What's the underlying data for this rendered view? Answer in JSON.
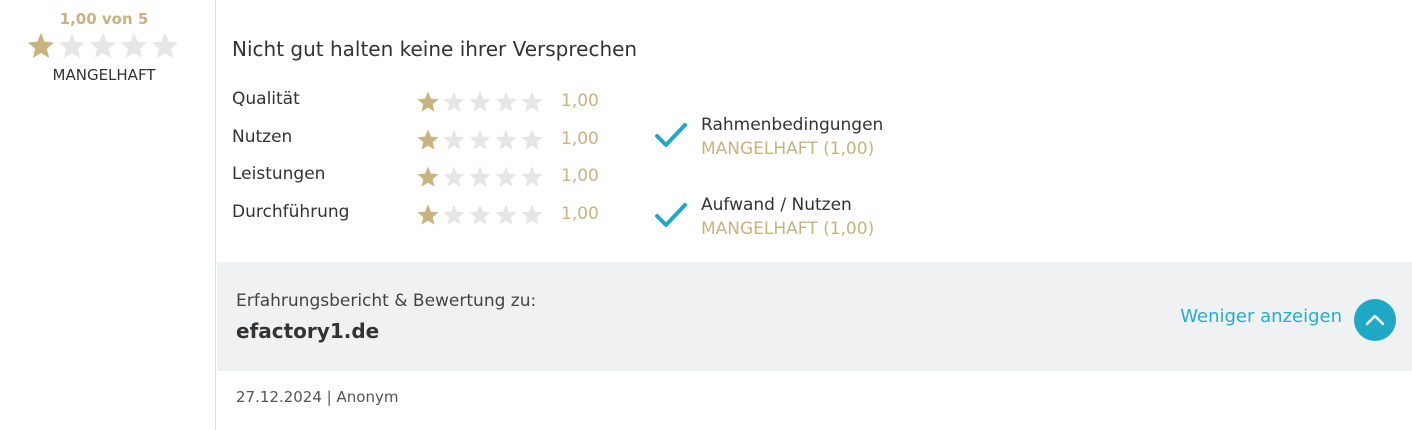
{
  "overall": {
    "score_label": "1,00 von 5",
    "rating": 1,
    "max_rating": 5,
    "verdict": "MANGELHAFT"
  },
  "review": {
    "title": "Nicht gut halten keine ihrer Versprechen"
  },
  "criteria": [
    {
      "label": "Qualität",
      "rating": 1,
      "value": "1,00"
    },
    {
      "label": "Nutzen",
      "rating": 1,
      "value": "1,00"
    },
    {
      "label": "Leistungen",
      "rating": 1,
      "value": "1,00"
    },
    {
      "label": "Durchführung",
      "rating": 1,
      "value": "1,00"
    }
  ],
  "recommendations": [
    {
      "title": "Rahmenbedingungen",
      "value": "MANGELHAFT (1,00)",
      "icon": "checkmark-icon"
    },
    {
      "title": "Aufwand / Nutzen",
      "value": "MANGELHAFT (1,00)",
      "icon": "checkmark-icon"
    }
  ],
  "summary": {
    "caption": "Erfahrungsbericht & Bewertung zu:",
    "domain": "efactory1.de",
    "less_label": "Weniger anzeigen",
    "less_icon": "chevron-up-icon"
  },
  "footer": {
    "date": "27.12.2024",
    "separator": "|",
    "author": "Anonym"
  },
  "colors": {
    "star_filled": "#c9b37e",
    "star_empty": "#e6e6e6",
    "accent": "#1fa9c4",
    "gold_text": "#c9b37e",
    "summary_bg": "#f0f1f3"
  }
}
